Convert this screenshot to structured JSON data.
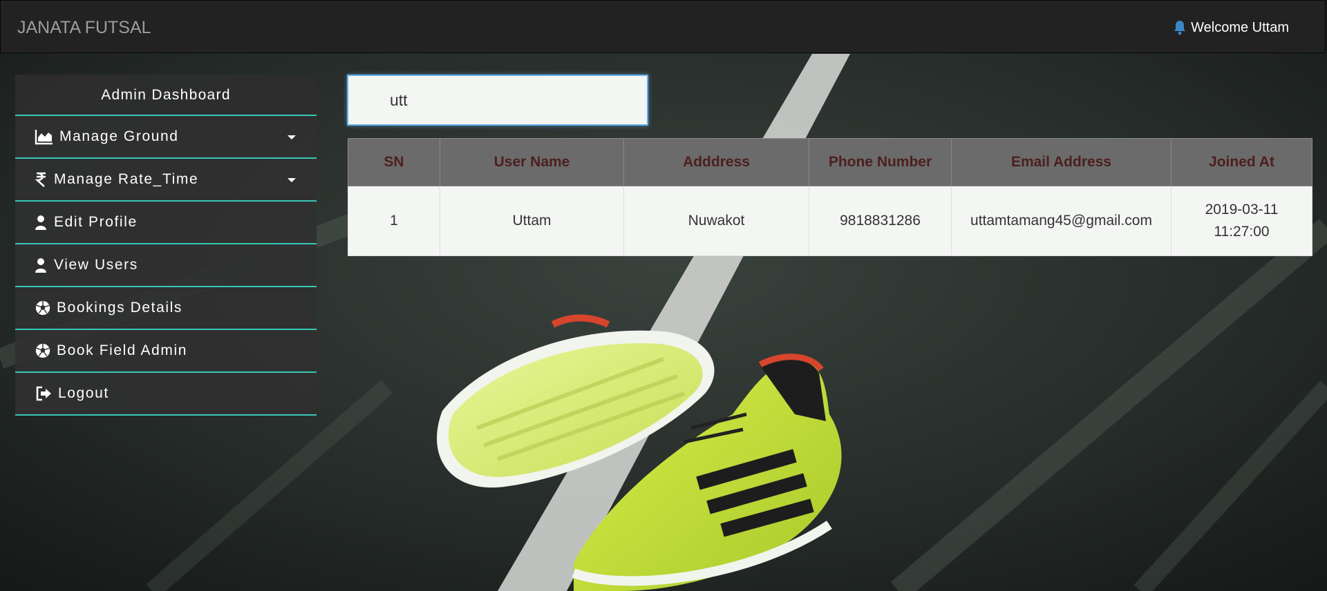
{
  "navbar": {
    "brand": "JANATA FUTSAL",
    "welcome": "Welcome Uttam",
    "welcome_icon": "bell-icon"
  },
  "sidebar": {
    "header": "Admin Dashboard",
    "items": [
      {
        "label": "Manage Ground",
        "icon": "area-chart-icon",
        "has_dropdown": true
      },
      {
        "label": "Manage Rate_Time",
        "icon": "rupee-icon",
        "has_dropdown": true
      },
      {
        "label": "Edit Profile",
        "icon": "user-icon",
        "has_dropdown": false
      },
      {
        "label": "View Users",
        "icon": "user-icon",
        "has_dropdown": false
      },
      {
        "label": "Bookings Details",
        "icon": "soccer-ball-icon",
        "has_dropdown": false
      },
      {
        "label": "Book Field Admin",
        "icon": "soccer-ball-icon",
        "has_dropdown": false
      },
      {
        "label": "Logout",
        "icon": "sign-out-icon",
        "has_dropdown": false
      }
    ]
  },
  "search": {
    "value": "utt"
  },
  "table": {
    "headers": [
      "SN",
      "User Name",
      "Adddress",
      "Phone Number",
      "Email Address",
      "Joined At"
    ],
    "rows": [
      {
        "sn": "1",
        "user_name": "Uttam",
        "address": "Nuwakot",
        "phone": "9818831286",
        "email": "uttamtamang45@gmail.com",
        "joined_date": "2019-03-11",
        "joined_time": "11:27:00"
      }
    ]
  },
  "colors": {
    "navbar_bg": "#222222",
    "brand_text": "#9d9d9d",
    "sidebar_accent": "#36c9b8",
    "table_header_bg": "#6b6b6b",
    "table_header_text": "#4d1f1f",
    "search_focus_border": "#66afe9"
  }
}
